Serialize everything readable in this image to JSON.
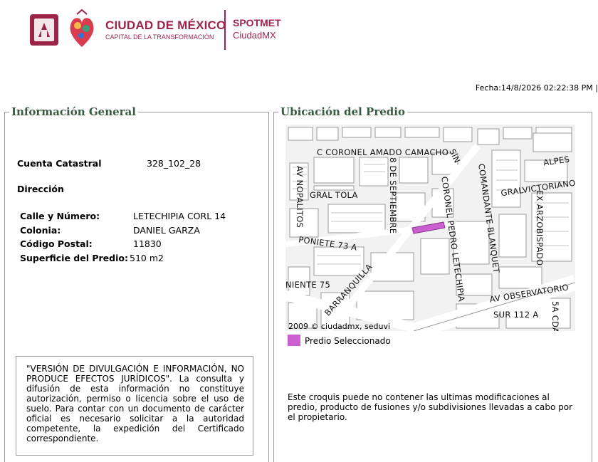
{
  "header": {
    "brand_title": "CIUDAD DE MÉXICO",
    "brand_subtitle": "CAPITAL DE LA TRANSFORMACIÓN",
    "system_name": "SPOTMET",
    "system_sub": "CiudadMX"
  },
  "fecha": "Fecha:14/8/2026 02:22:38 PM |",
  "info": {
    "legend": "Información General",
    "cuenta_label": "Cuenta Catastral",
    "cuenta_value": "328_102_28",
    "direccion_label": "Dirección",
    "calle_label": "Calle y Número:",
    "calle_value": "LETECHIPIA CORL 14",
    "colonia_label": "Colonia:",
    "colonia_value": "DANIEL GARZA",
    "cp_label": "Código Postal:",
    "cp_value": "11830",
    "superficie_label": "Superficie del Predio:",
    "superficie_value": "510 m2",
    "disclaimer": "\"VERSIÓN DE DIVULGACIÓN E INFORMACIÓN, NO PRODUCE EFECTOS JURÍDICOS\". La consulta y difusión de esta información no constituye autorización, permiso o licencia sobre el uso de suelo. Para contar con un documento de carácter oficial es necesario solicitar a la autoridad competente, la expedición del Certificado correspondiente."
  },
  "map": {
    "legend": "Ubicación del Predio",
    "streets": {
      "amado_camacho": "C CORONEL AMADO CAMACHO",
      "sin": "SIN",
      "alpes": "ALPES",
      "nopalitos": "AV NOPALITOS",
      "septiembre": "8 DE SEPTIEMBRE",
      "tola": "GRAL TOLA",
      "pedro_letechipia": "CORONEL PEDRO LETECHIPIA",
      "blanquet": "COMANDANTE BLANQUET",
      "victoriano": "GRALVICTORIANO",
      "arzobispado": "EX ARZOBISPADO",
      "poniete": "PONIETE 73 A",
      "niente": "NIENTE 75",
      "barranquilla": "BARRANQUILLA",
      "observatorio": "AV OBSERVATORIO",
      "sur112": "SUR 112 A",
      "cda": "5A CDA"
    },
    "copyright": "2009 © ciudadmx, seduvi",
    "legend_item": "Predio Seleccionado",
    "legend_color": "#cc5fd0",
    "note": "Este croquis puede no contener las ultimas modificaciones al predio, producto de fusiones y/o subdivisiones llevadas a cabo por el propietario."
  }
}
